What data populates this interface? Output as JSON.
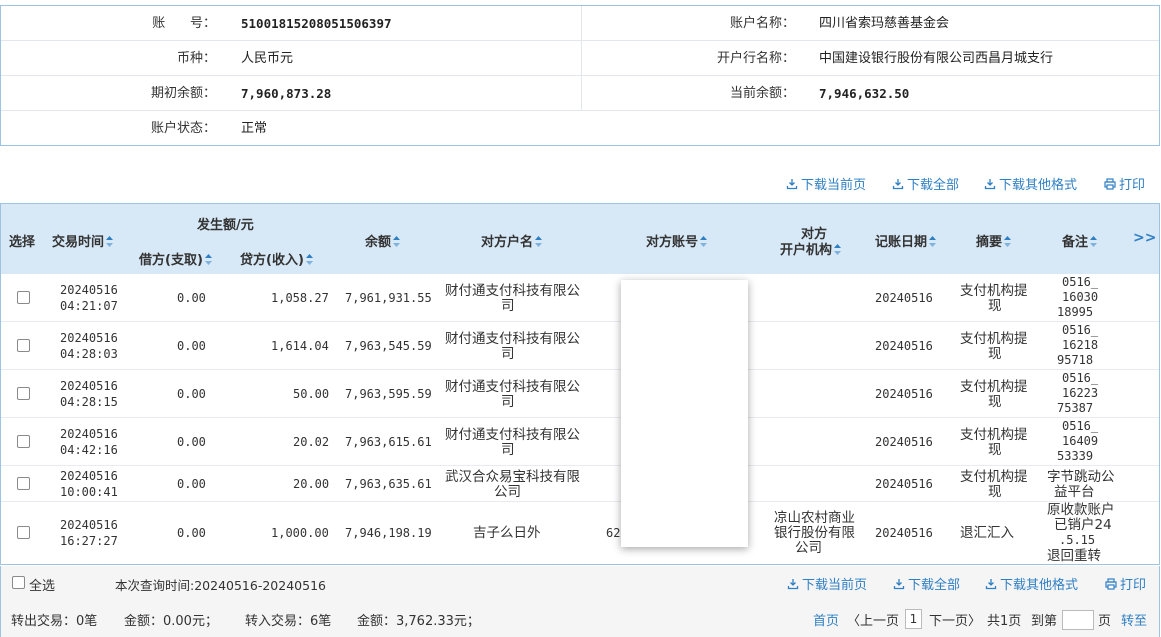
{
  "account": {
    "number_label": "账      号：",
    "number": "51001815208051506397",
    "name_label": "账户名称：",
    "name": "四川省索玛慈善基金会",
    "currency_label": "币种：",
    "currency": "人民币元",
    "bank_label": "开户行名称：",
    "bank": "中国建设银行股份有限公司西昌月城支行",
    "opening_balance_label": "期初余额：",
    "opening_balance": "7,960,873.28",
    "current_balance_label": "当前余额：",
    "current_balance": "7,946,632.50",
    "status_label": "账户状态：",
    "status": "正常"
  },
  "toolbar": {
    "download_page": "下载当前页",
    "download_all": "下载全部",
    "download_other": "下载其他格式",
    "print": "打印"
  },
  "table": {
    "headers": {
      "select": "选择",
      "time": "交易时间",
      "amount_group": "发生额/元",
      "debit": "借方(支取)",
      "credit": "贷方(收入)",
      "balance": "余额",
      "counterparty_name": "对方户名",
      "counterparty_account": "对方账号",
      "counterparty_bank_1": "对方",
      "counterparty_bank_2": "开户机构",
      "post_date": "记账日期",
      "summary": "摘要",
      "remark": "备注",
      "more": ">>"
    },
    "rows": [
      {
        "date": "20240516",
        "time": "04:21:07",
        "debit": "0.00",
        "credit": "1,058.27",
        "balance": "7,961,931.55",
        "name_1": "财付通支付科技有限公",
        "name_2": "司",
        "account": "",
        "bank": [
          "",
          "",
          ""
        ],
        "post_date": "20240516",
        "summary_1": "支付机构提",
        "summary_2": "现",
        "remark": [
          "0516_",
          "16030",
          "18995"
        ]
      },
      {
        "date": "20240516",
        "time": "04:28:03",
        "debit": "0.00",
        "credit": "1,614.04",
        "balance": "7,963,545.59",
        "name_1": "财付通支付科技有限公",
        "name_2": "司",
        "account": "",
        "bank": [
          "",
          "",
          ""
        ],
        "post_date": "20240516",
        "summary_1": "支付机构提",
        "summary_2": "现",
        "remark": [
          "0516_",
          "16218",
          "95718"
        ]
      },
      {
        "date": "20240516",
        "time": "04:28:15",
        "debit": "0.00",
        "credit": "50.00",
        "balance": "7,963,595.59",
        "name_1": "财付通支付科技有限公",
        "name_2": "司",
        "account": "",
        "bank": [
          "",
          "",
          ""
        ],
        "post_date": "20240516",
        "summary_1": "支付机构提",
        "summary_2": "现",
        "remark": [
          "0516_",
          "16223",
          "75387"
        ]
      },
      {
        "date": "20240516",
        "time": "04:42:16",
        "debit": "0.00",
        "credit": "20.02",
        "balance": "7,963,615.61",
        "name_1": "财付通支付科技有限公",
        "name_2": "司",
        "account": "",
        "bank": [
          "",
          "",
          ""
        ],
        "post_date": "20240516",
        "summary_1": "支付机构提",
        "summary_2": "现",
        "remark": [
          "0516_",
          "16409",
          "53339"
        ]
      },
      {
        "date": "20240516",
        "time": "10:00:41",
        "debit": "0.00",
        "credit": "20.00",
        "balance": "7,963,635.61",
        "name_1": "武汉合众易宝科技有限",
        "name_2": "公司",
        "account": "",
        "bank": [
          "",
          "",
          ""
        ],
        "post_date": "20240516",
        "summary_1": "支付机构提",
        "summary_2": "现",
        "remark": [
          "字节跳动公",
          "益平台"
        ]
      },
      {
        "date": "20240516",
        "time": "16:27:27",
        "debit": "0.00",
        "credit": "1,000.00",
        "balance": "7,946,198.19",
        "name_1": "吉子么日外",
        "name_2": "",
        "account": "62",
        "bank": [
          "凉山农村商业",
          "银行股份有限",
          "公司"
        ],
        "post_date": "20240516",
        "summary_1": "退汇汇入",
        "summary_2": "",
        "remark": [
          "原收款账户",
          "已销户24",
          ".5.15",
          "退回重转"
        ]
      }
    ]
  },
  "footer": {
    "select_all": "全选",
    "query_time": "本次查询时间:20240516-20240516",
    "out_tx": "转出交易：0笔",
    "out_amount": "金额：0.00元；",
    "in_tx": "转入交易：6笔",
    "in_amount": "金额：3,762.33元；",
    "first": "首页",
    "prev": "〈上一页",
    "page": "1",
    "next": "下一页〉",
    "total": "共1页",
    "goto": "到第",
    "page_unit": "页",
    "go": "转至"
  },
  "colors": {
    "link": "#2f7fc4",
    "header_bg": "#d7e8f6",
    "border": "#9ec3e0"
  }
}
